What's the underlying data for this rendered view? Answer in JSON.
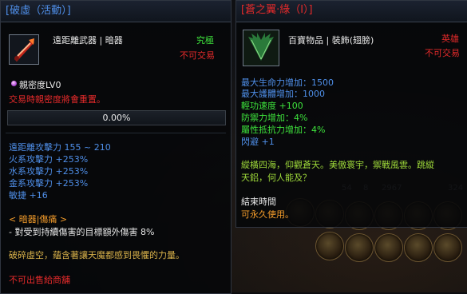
{
  "background": {
    "numbers": [
      "54",
      "8",
      "2967",
      "324"
    ]
  },
  "left_panel": {
    "title": "[破虛（活動）]",
    "item_type": "遠距離武器 | 暗器",
    "quality": "究極",
    "trade": "不可交易",
    "affinity_label": "親密度LV0",
    "affinity_note": "交易時親密度將會重置。",
    "progress_text": "0.00%",
    "progress_value": 0.0,
    "stats": [
      "遠距離攻擊力 155 ~ 210",
      "火系攻擊力 +253%",
      "水系攻擊力 +253%",
      "金系攻擊力 +253%",
      "敏捷 +16"
    ],
    "special_title": "< 暗器|傷痛 >",
    "special_desc": "- 對受到持續傷害的目標額外傷害 8%",
    "lore": "破碎虛空，蘊含著讓天魔都感到畏懼的力量。",
    "no_sell": "不可出售給商舖"
  },
  "right_panel": {
    "title": "[蒼之翼·綠（Ⅰ）]",
    "item_type": "百寶物品 | 裝飾(翅膀)",
    "quality": "英雄",
    "trade": "不可交易",
    "stats_blue": [
      "最大生命力增加：1500",
      "最大護體增加：1000"
    ],
    "stats_green": [
      "輕功速度 +100",
      "防禦力增加：4%",
      "屬性抵抗力增加：4%",
      "閃避 +1"
    ],
    "lore_line1": "縱橫四海，仰觀蒼天。美傲寰宇，禦戰風雲。跳縱",
    "lore_line2": "天鋁，何人能及？",
    "end_time_label": "結束時間",
    "end_time_value": "可永久使用。"
  }
}
